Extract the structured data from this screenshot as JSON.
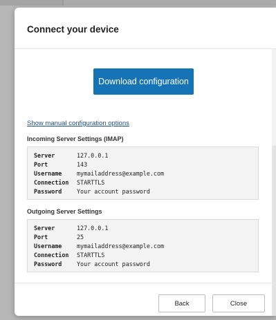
{
  "dialog": {
    "title": "Connect your device",
    "download_label": "Download configuration",
    "manual_link": "Show manual configuration options"
  },
  "incoming": {
    "heading": "Incoming Server Settings (IMAP)",
    "rows": [
      {
        "key": "Server",
        "value": "127.0.0.1"
      },
      {
        "key": "Port",
        "value": "143"
      },
      {
        "key": "Username",
        "value": "mymailaddress@example.com"
      },
      {
        "key": "Connection",
        "value": "STARTTLS"
      },
      {
        "key": "Password",
        "value": "Your account password"
      }
    ]
  },
  "outgoing": {
    "heading": "Outgoing Server Settings",
    "rows": [
      {
        "key": "Server",
        "value": "127.0.0.1"
      },
      {
        "key": "Port",
        "value": "25"
      },
      {
        "key": "Username",
        "value": "mymailaddress@example.com"
      },
      {
        "key": "Connection",
        "value": "STARTTLS"
      },
      {
        "key": "Password",
        "value": "Your account password"
      }
    ]
  },
  "footer": {
    "back_label": "Back",
    "close_label": "Close"
  },
  "colors": {
    "primary": "#1673b6",
    "link": "#1a4f8a",
    "backdrop": "#b7b7b7"
  }
}
